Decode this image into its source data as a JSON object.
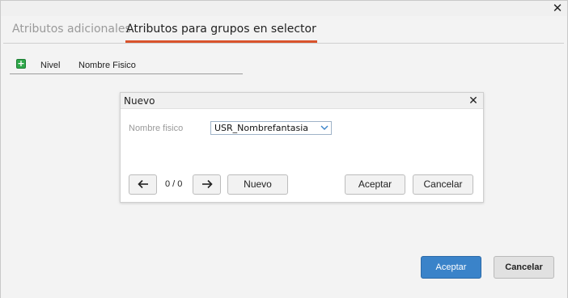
{
  "outer_window": {
    "close_glyph": "✕",
    "tabs": [
      {
        "label": "Atributos adicionales",
        "active": false
      },
      {
        "label": "Atributos para grupos en selector",
        "active": true
      }
    ],
    "table": {
      "add_icon": "plus-icon",
      "columns": [
        "Nivel",
        "Nombre Fisico"
      ]
    },
    "buttons": {
      "accept": "Aceptar",
      "cancel": "Cancelar"
    }
  },
  "modal": {
    "title": "Nuevo",
    "close_glyph": "✕",
    "field": {
      "label": "Nombre fisico",
      "value": "USR_Nombrefantasia"
    },
    "pager": "0 / 0",
    "buttons": {
      "prev_icon": "arrow-left-icon",
      "next_icon": "arrow-right-icon",
      "new": "Nuevo",
      "accept": "Aceptar",
      "cancel": "Cancelar"
    }
  },
  "colors": {
    "accent_tab": "#d9532c",
    "primary_button": "#3a83c9",
    "add_icon": "#2fa84a"
  }
}
